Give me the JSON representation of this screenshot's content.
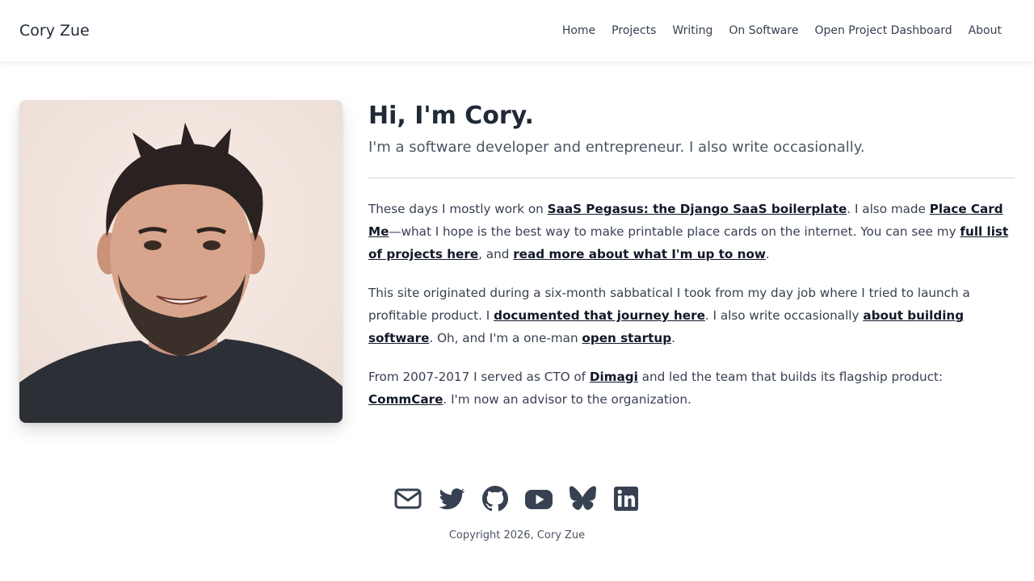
{
  "navbar": {
    "brand": "Cory Zue",
    "links": [
      {
        "label": "Home"
      },
      {
        "label": "Projects"
      },
      {
        "label": "Writing"
      },
      {
        "label": "On Software"
      },
      {
        "label": "Open Project Dashboard"
      },
      {
        "label": "About"
      }
    ]
  },
  "hero": {
    "title": "Hi, I'm Cory.",
    "subtitle": "I'm a software developer and entrepreneur. I also write occasionally."
  },
  "paragraphs": [
    {
      "t1": "These days I mostly work on ",
      "l1": "SaaS Pegasus: the Django SaaS boilerplate",
      "t2": ". I also made ",
      "l2": "Place Card Me",
      "t3": "—what I hope is the best way to make printable place cards on the internet. You can see my ",
      "l3": "full list of projects here",
      "t4": ", and ",
      "l4": "read more about what I'm up to now",
      "t5": "."
    },
    {
      "t1": "This site originated during a six-month sabbatical I took from my day job where I tried to launch a profitable product. I ",
      "l1": "documented that journey here",
      "t2": ". I also write occasionally ",
      "l2": "about building software",
      "t3": ". Oh, and I'm a one-man ",
      "l3": "open startup",
      "t4": "."
    },
    {
      "t1": "From 2007-2017 I served as CTO of ",
      "l1": "Dimagi",
      "t2": " and led the team that builds its flagship product: ",
      "l2": "CommCare",
      "t3": ". I'm now an advisor to the organization."
    }
  ],
  "social": {
    "icons": [
      "envelope-icon",
      "twitter-icon",
      "github-icon",
      "youtube-icon",
      "bluesky-icon",
      "linkedin-icon"
    ],
    "icon_color": "#374151"
  },
  "footer": {
    "copyright": "Copyright 2026, Cory Zue"
  },
  "colors": {
    "text": "#374151",
    "heading": "#1f2937",
    "link": "#111827",
    "divider": "#d1d5db"
  }
}
